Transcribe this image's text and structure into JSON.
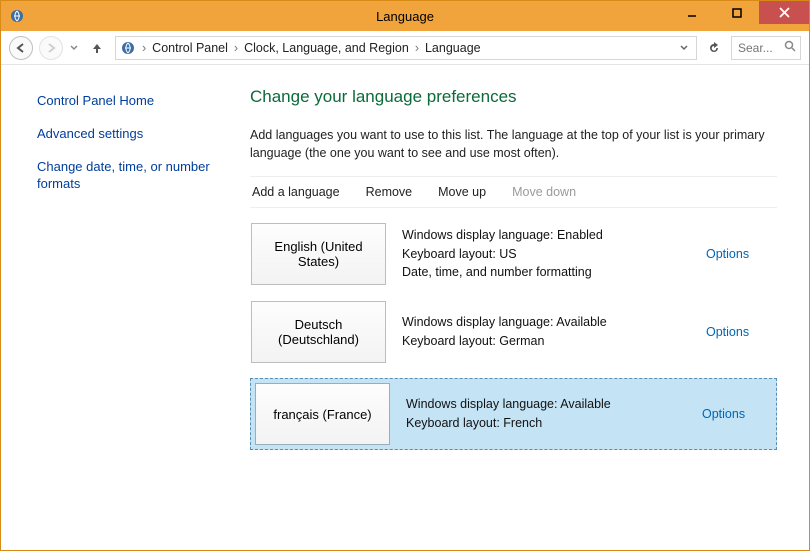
{
  "window": {
    "title": "Language"
  },
  "breadcrumbs": {
    "items": [
      "Control Panel",
      "Clock, Language, and Region",
      "Language"
    ]
  },
  "search": {
    "placeholder": "Sear..."
  },
  "sidebar": {
    "home": "Control Panel Home",
    "advanced": "Advanced settings",
    "changedate": "Change date, time, or number formats"
  },
  "main": {
    "heading": "Change your language preferences",
    "subtext": "Add languages you want to use to this list. The language at the top of your list is your primary language (the one you want to see and use most often).",
    "toolbar": {
      "add": "Add a language",
      "remove": "Remove",
      "moveup": "Move up",
      "movedown": "Move down"
    },
    "languages": [
      {
        "name": "English (United States)",
        "details": "Windows display language: Enabled\nKeyboard layout: US\nDate, time, and number formatting",
        "options": "Options",
        "selected": false
      },
      {
        "name": "Deutsch (Deutschland)",
        "details": "Windows display language: Available\nKeyboard layout: German",
        "options": "Options",
        "selected": false
      },
      {
        "name": "français (France)",
        "details": "Windows display language: Available\nKeyboard layout: French",
        "options": "Options",
        "selected": true
      }
    ]
  }
}
